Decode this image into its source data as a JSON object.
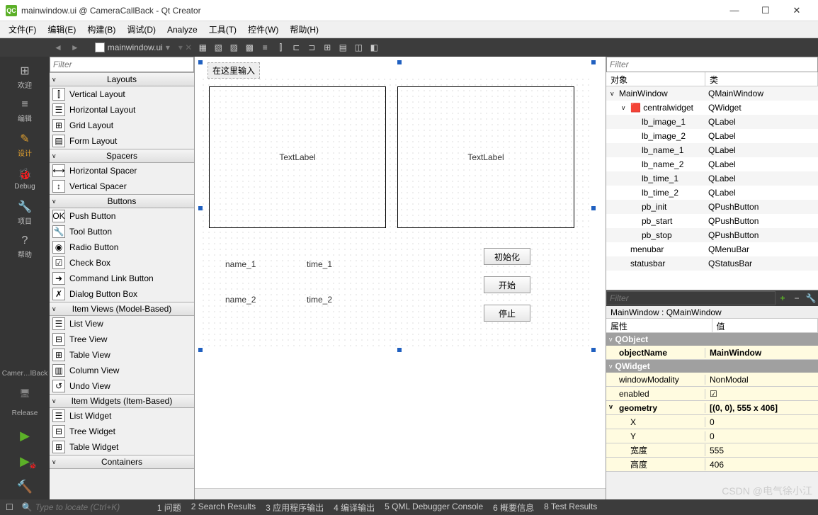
{
  "window": {
    "title": "mainwindow.ui @ CameraCallBack - Qt Creator"
  },
  "menu": [
    "文件(F)",
    "编辑(E)",
    "构建(B)",
    "调试(D)",
    "Analyze",
    "工具(T)",
    "控件(W)",
    "帮助(H)"
  ],
  "tab": {
    "file": "mainwindow.ui"
  },
  "leftnav": [
    {
      "label": "欢迎",
      "icon": "⊞"
    },
    {
      "label": "编辑",
      "icon": "≡"
    },
    {
      "label": "设计",
      "icon": "✎",
      "active": true
    },
    {
      "label": "Debug",
      "icon": "🐞"
    },
    {
      "label": "项目",
      "icon": "🔧"
    },
    {
      "label": "帮助",
      "icon": "?"
    }
  ],
  "leftnav_bottom": {
    "project": "Camer…lBack",
    "config": "Release"
  },
  "widgetbox": {
    "filter_placeholder": "Filter",
    "categories": [
      {
        "name": "Layouts",
        "items": [
          {
            "label": "Vertical Layout",
            "icon": "⫿"
          },
          {
            "label": "Horizontal Layout",
            "icon": "☰"
          },
          {
            "label": "Grid Layout",
            "icon": "⊞"
          },
          {
            "label": "Form Layout",
            "icon": "▤"
          }
        ]
      },
      {
        "name": "Spacers",
        "items": [
          {
            "label": "Horizontal Spacer",
            "icon": "⟷"
          },
          {
            "label": "Vertical Spacer",
            "icon": "↕"
          }
        ]
      },
      {
        "name": "Buttons",
        "items": [
          {
            "label": "Push Button",
            "icon": "OK"
          },
          {
            "label": "Tool Button",
            "icon": "🔧"
          },
          {
            "label": "Radio Button",
            "icon": "◉"
          },
          {
            "label": "Check Box",
            "icon": "☑"
          },
          {
            "label": "Command Link Button",
            "icon": "➜"
          },
          {
            "label": "Dialog Button Box",
            "icon": "✗"
          }
        ]
      },
      {
        "name": "Item Views (Model-Based)",
        "items": [
          {
            "label": "List View",
            "icon": "☰"
          },
          {
            "label": "Tree View",
            "icon": "⊟"
          },
          {
            "label": "Table View",
            "icon": "⊞"
          },
          {
            "label": "Column View",
            "icon": "▥"
          },
          {
            "label": "Undo View",
            "icon": "↺"
          }
        ]
      },
      {
        "name": "Item Widgets (Item-Based)",
        "items": [
          {
            "label": "List Widget",
            "icon": "☰"
          },
          {
            "label": "Tree Widget",
            "icon": "⊟"
          },
          {
            "label": "Table Widget",
            "icon": "⊞"
          }
        ]
      },
      {
        "name": "Containers",
        "items": []
      }
    ]
  },
  "form": {
    "type_here": "在这里输入",
    "textlabel1": "TextLabel",
    "textlabel2": "TextLabel",
    "name1": "name_1",
    "time1": "time_1",
    "name2": "name_2",
    "time2": "time_2",
    "btn_init": "初始化",
    "btn_start": "开始",
    "btn_stop": "停止"
  },
  "object_inspector": {
    "filter_placeholder": "Filter",
    "headers": {
      "object": "对象",
      "class": "类"
    },
    "tree": [
      {
        "name": "MainWindow",
        "cls": "QMainWindow",
        "indent": 0,
        "caret": "v"
      },
      {
        "name": "centralwidget",
        "cls": "QWidget",
        "indent": 1,
        "caret": "v",
        "icon": "🟥"
      },
      {
        "name": "lb_image_1",
        "cls": "QLabel",
        "indent": 2
      },
      {
        "name": "lb_image_2",
        "cls": "QLabel",
        "indent": 2
      },
      {
        "name": "lb_name_1",
        "cls": "QLabel",
        "indent": 2
      },
      {
        "name": "lb_name_2",
        "cls": "QLabel",
        "indent": 2
      },
      {
        "name": "lb_time_1",
        "cls": "QLabel",
        "indent": 2
      },
      {
        "name": "lb_time_2",
        "cls": "QLabel",
        "indent": 2
      },
      {
        "name": "pb_init",
        "cls": "QPushButton",
        "indent": 2
      },
      {
        "name": "pb_start",
        "cls": "QPushButton",
        "indent": 2
      },
      {
        "name": "pb_stop",
        "cls": "QPushButton",
        "indent": 2
      },
      {
        "name": "menubar",
        "cls": "QMenuBar",
        "indent": 1
      },
      {
        "name": "statusbar",
        "cls": "QStatusBar",
        "indent": 1
      }
    ]
  },
  "properties": {
    "filter_placeholder": "Filter",
    "breadcrumb": "MainWindow : QMainWindow",
    "headers": {
      "prop": "属性",
      "val": "值"
    },
    "rows": [
      {
        "type": "group",
        "label": "QObject"
      },
      {
        "type": "prop",
        "name": "objectName",
        "value": "MainWindow",
        "indent": 0,
        "bold": true
      },
      {
        "type": "group",
        "label": "QWidget"
      },
      {
        "type": "prop",
        "name": "windowModality",
        "value": "NonModal",
        "indent": 0
      },
      {
        "type": "prop",
        "name": "enabled",
        "value": "☑",
        "indent": 0
      },
      {
        "type": "prop",
        "name": "geometry",
        "value": "[(0, 0), 555 x 406]",
        "indent": 0,
        "bold": true,
        "caret": "v"
      },
      {
        "type": "prop",
        "name": "X",
        "value": "0",
        "indent": 1
      },
      {
        "type": "prop",
        "name": "Y",
        "value": "0",
        "indent": 1
      },
      {
        "type": "prop",
        "name": "宽度",
        "value": "555",
        "indent": 1
      },
      {
        "type": "prop",
        "name": "高度",
        "value": "406",
        "indent": 1
      }
    ]
  },
  "statusbar": {
    "search_placeholder": "Type to locate (Ctrl+K)",
    "items": [
      "1 问题",
      "2 Search Results",
      "3 应用程序输出",
      "4 编译输出",
      "5 QML Debugger Console",
      "6 概要信息",
      "8 Test Results"
    ]
  },
  "watermark": "CSDN @电气徐小江"
}
